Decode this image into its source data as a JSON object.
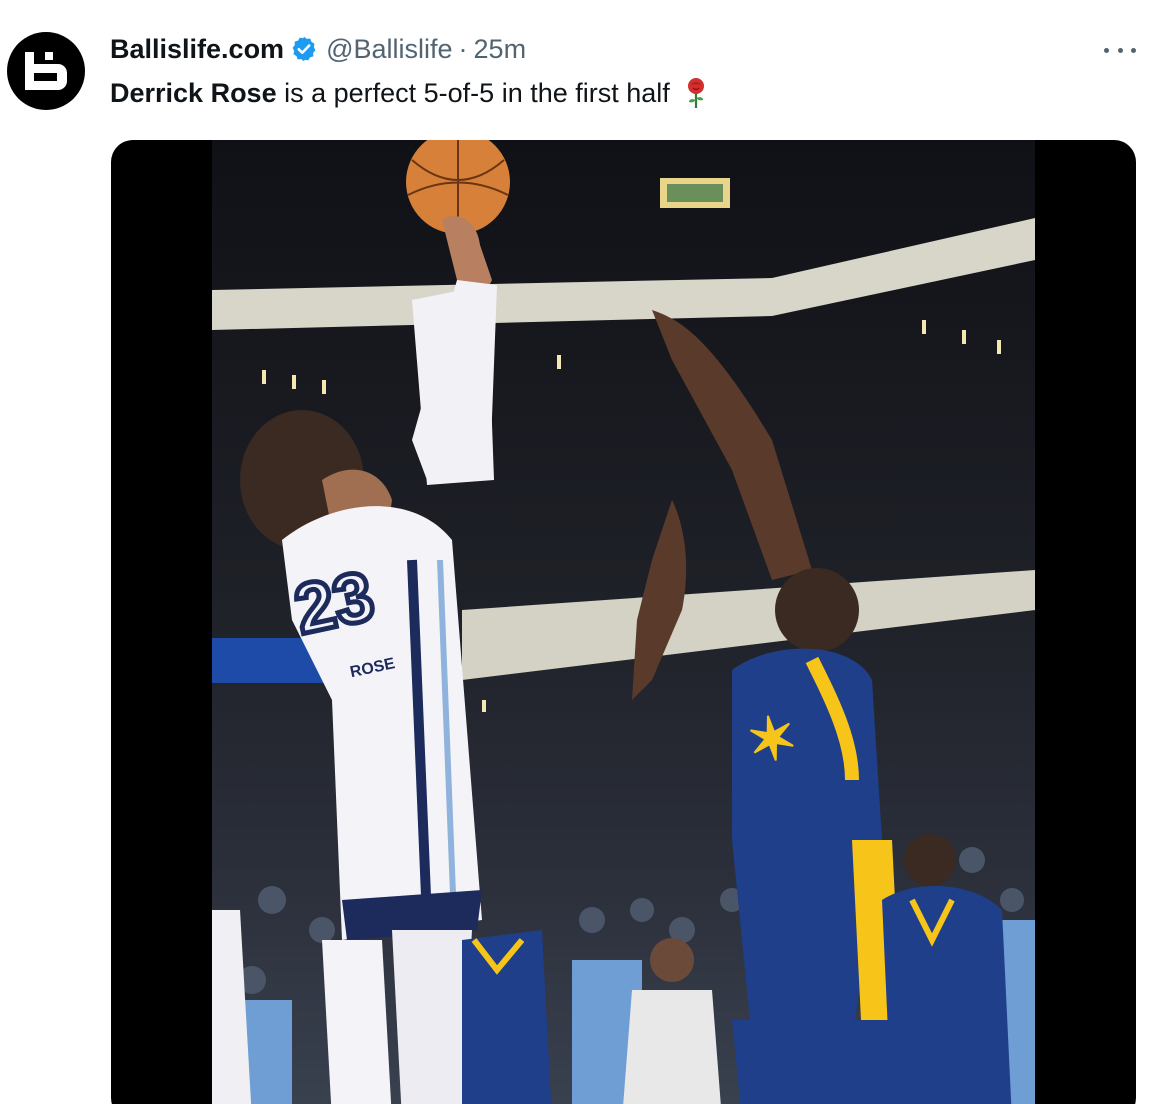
{
  "tweet": {
    "display_name": "Ballislife.com",
    "handle": "@Ballislife",
    "separator": "·",
    "timestamp": "25m",
    "text_bold": "Derrick Rose",
    "text_rest": " is a perfect 5-of-5 in the first half",
    "emoji": "rose"
  },
  "media": {
    "jersey_number": "23",
    "jersey_name": "ROSE"
  },
  "icons": {
    "avatar": "ballislife-logo-icon",
    "verified": "verified-badge-icon",
    "more": "more-options-icon"
  },
  "colors": {
    "verified": "#1d9bf0",
    "text": "#0f1419",
    "muted": "#536471",
    "grizzlies_navy": "#1d2a5c",
    "pacers_navy": "#0c2c6b",
    "pacers_gold": "#f7c41a"
  }
}
